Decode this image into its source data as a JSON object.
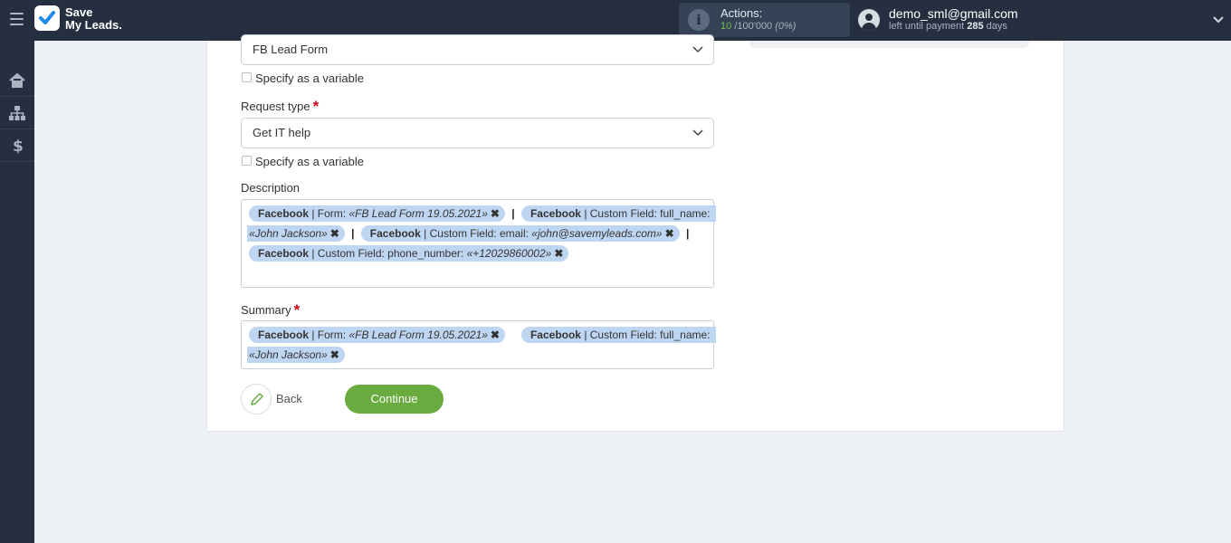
{
  "header": {
    "logo_line1": "Save",
    "logo_line2": "My Leads.",
    "actions_label": "Actions:",
    "actions_used": "10",
    "actions_total": "/100'000",
    "actions_percent": "(0%)",
    "user_email": "demo_sml@gmail.com",
    "payment_prefix": "left until payment",
    "payment_days": "285",
    "payment_suffix": "days"
  },
  "form": {
    "form_select_value": "FB Lead Form",
    "variable_label_1": "Specify as a variable",
    "request_type_label": "Request type",
    "required_mark": "*",
    "request_type_value": "Get IT help",
    "variable_label_2": "Specify as a variable",
    "description_label": "Description",
    "summary_label": "Summary",
    "description": {
      "t1_src": "Facebook",
      "t1_text": " | Form: ",
      "t1_val": "«FB Lead Form 19.05.2021»",
      "sep1": "|",
      "t2_src": "Facebook",
      "t2_text": " | Custom Field: full_name:",
      "t2_val": "«John Jackson»",
      "sep2": "|",
      "t3_src": "Facebook",
      "t3_text": " | Custom Field: email: ",
      "t3_val": "«john@savemyleads.com»",
      "sep3": "|",
      "t4_src": "Facebook",
      "t4_text": " | Custom Field: phone_number: ",
      "t4_val": "«+12029860002»"
    },
    "summary": {
      "t1_src": "Facebook",
      "t1_text": " | Form: ",
      "t1_val": "«FB Lead Form 19.05.2021»",
      "t2_src": "Facebook",
      "t2_text": " | Custom Field: full_name:",
      "t2_val": "«John Jackson»"
    },
    "remove_glyph": "✖",
    "back_label": "Back",
    "continue_label": "Continue"
  },
  "icons": {
    "menu": "hamburger-icon",
    "logo": "checkmark-logo-icon",
    "info": "info-icon",
    "user": "user-avatar-icon",
    "dropdown": "chevron-down-icon",
    "home": "home-icon",
    "connections": "sitemap-icon",
    "billing": "dollar-icon",
    "edit": "pencil-icon"
  },
  "colors": {
    "topbar": "#252f3f",
    "accent_green": "#6aab3f",
    "tag_blue": "#bfd6f2",
    "required_red": "#d0021b"
  }
}
